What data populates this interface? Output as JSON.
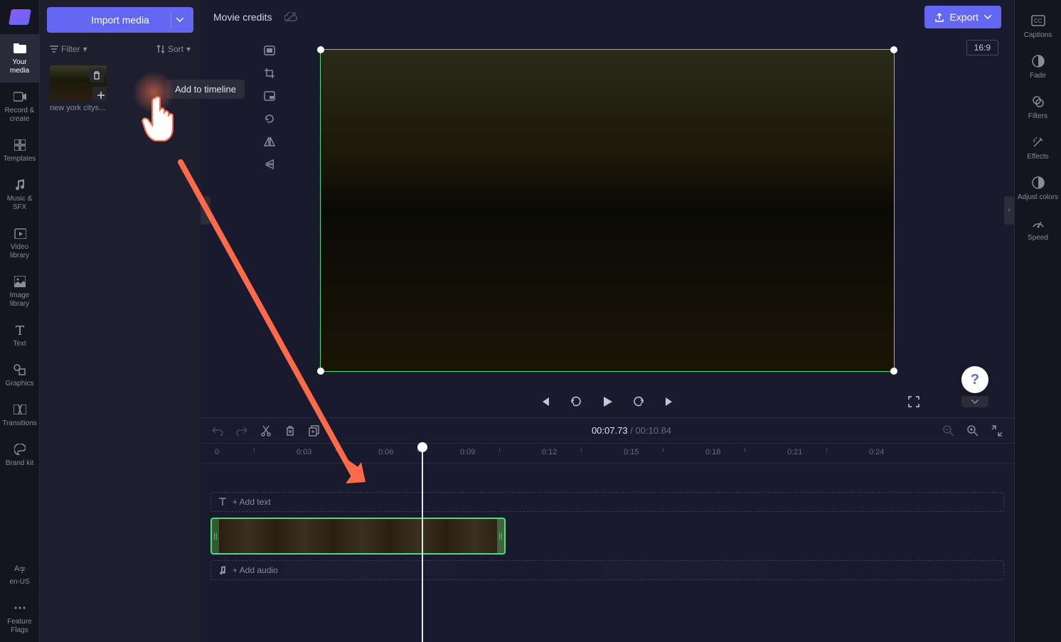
{
  "app": {
    "projectTitle": "Movie credits"
  },
  "leftNav": {
    "items": [
      {
        "label": "Your media"
      },
      {
        "label": "Record & create"
      },
      {
        "label": "Templates"
      },
      {
        "label": "Music & SFX"
      },
      {
        "label": "Video library"
      },
      {
        "label": "Image library"
      },
      {
        "label": "Text"
      },
      {
        "label": "Graphics"
      },
      {
        "label": "Transitions"
      },
      {
        "label": "Brand kit"
      }
    ],
    "lang": "en-US",
    "flags": "Feature Flags"
  },
  "mediaPanel": {
    "importLabel": "Import media",
    "filterLabel": "Filter",
    "sortLabel": "Sort",
    "thumbName": "new york citys...",
    "tooltip": "Add to timeline"
  },
  "topBar": {
    "exportLabel": "Export",
    "aspect": "16:9"
  },
  "playback": {
    "currentTime": "00:07.73",
    "totalTime": "00:10.84"
  },
  "ruler": {
    "marks": [
      "0",
      "0:03",
      "0:06",
      "0:09",
      "0:12",
      "0:15",
      "0:18",
      "0:21",
      "0:24"
    ]
  },
  "tracks": {
    "addText": "+ Add text",
    "addAudio": "+ Add audio"
  },
  "rightNav": {
    "items": [
      {
        "label": "Captions"
      },
      {
        "label": "Fade"
      },
      {
        "label": "Filters"
      },
      {
        "label": "Effects"
      },
      {
        "label": "Adjust colors"
      },
      {
        "label": "Speed"
      }
    ]
  }
}
